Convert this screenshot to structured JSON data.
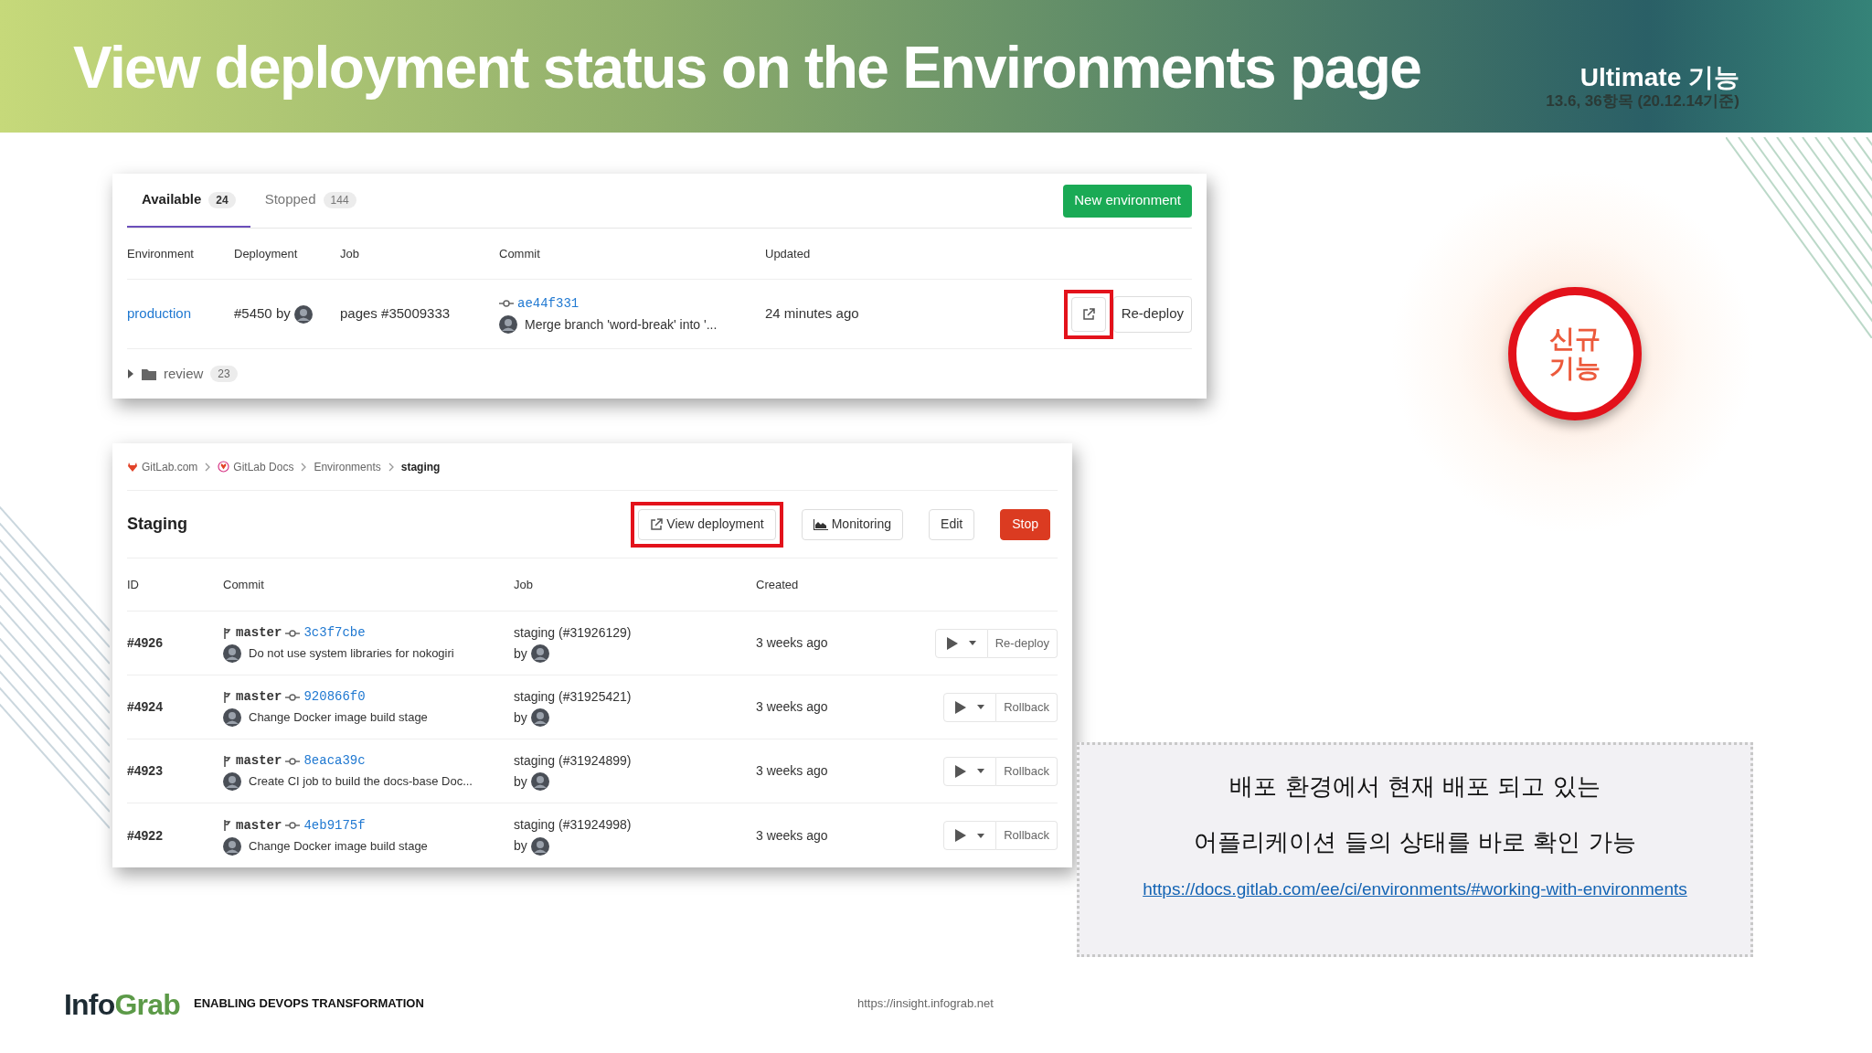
{
  "header": {
    "title": "View deployment status on the Environments page",
    "edition": "Ultimate 기능",
    "version_note": "13.6, 36항목 (20.12.14기준)"
  },
  "environments_panel": {
    "tabs": [
      {
        "label": "Available",
        "count": "24",
        "selected": true
      },
      {
        "label": "Stopped",
        "count": "144",
        "selected": false
      }
    ],
    "new_button": "New environment",
    "columns": [
      "Environment",
      "Deployment",
      "Job",
      "Commit",
      "Updated"
    ],
    "rows": [
      {
        "environment": "production",
        "deployment": "#5450 by",
        "job": "pages #35009333",
        "commit_sha": "ae44f331",
        "commit_message": "Merge branch 'word-break' into '...",
        "updated": "24 minutes ago",
        "open_highlighted": true,
        "action": "Re-deploy"
      }
    ],
    "folders": [
      {
        "name": "review",
        "count": "23",
        "expanded": false
      }
    ]
  },
  "environment_detail": {
    "breadcrumb": [
      {
        "label": "GitLab.com",
        "kind": "gitlab"
      },
      {
        "label": "GitLab Docs",
        "kind": "docs"
      },
      {
        "label": "Environments",
        "kind": "plain"
      },
      {
        "label": "staging",
        "kind": "current"
      }
    ],
    "title": "Staging",
    "buttons": [
      {
        "label": "View deployment",
        "kind": "view",
        "highlighted": true
      },
      {
        "label": "Monitoring",
        "kind": "monitoring",
        "highlighted": false
      },
      {
        "label": "Edit",
        "kind": "plain",
        "highlighted": false
      },
      {
        "label": "Stop",
        "kind": "danger",
        "highlighted": false
      }
    ],
    "columns": [
      "ID",
      "Commit",
      "Job",
      "Created"
    ],
    "rows": [
      {
        "id": "#4926",
        "branch": "master",
        "sha": "3c3f7cbe",
        "message": "Do not use system libraries for nokogiri",
        "job": "staging (#31926129)",
        "by": "by",
        "created": "3 weeks ago",
        "action": "Re-deploy"
      },
      {
        "id": "#4924",
        "branch": "master",
        "sha": "920866f0",
        "message": "Change Docker image build stage",
        "job": "staging (#31925421)",
        "by": "by",
        "created": "3 weeks ago",
        "action": "Rollback"
      },
      {
        "id": "#4923",
        "branch": "master",
        "sha": "8eaca39c",
        "message": "Create CI job to build the docs-base Doc...",
        "job": "staging (#31924899)",
        "by": "by",
        "created": "3 weeks ago",
        "action": "Rollback"
      },
      {
        "id": "#4922",
        "branch": "master",
        "sha": "4eb9175f",
        "message": "Change Docker image build stage",
        "job": "staging (#31924998)",
        "by": "by",
        "created": "3 weeks ago",
        "action": "Rollback"
      }
    ]
  },
  "badge": {
    "lines": [
      "신규",
      "기능"
    ]
  },
  "note": {
    "lines": [
      "배포 환경에서 현재 배포 되고 있는",
      "어플리케이션 들의 상태를 바로 확인 가능"
    ],
    "link": "https://docs.gitlab.com/ee/ci/environments/#working-with-environments"
  },
  "footer": {
    "logo_first": "Info",
    "logo_second": "Grab",
    "tagline": "ENABLING DEVOPS TRANSFORMATION",
    "url": "https://insight.infograb.net"
  }
}
